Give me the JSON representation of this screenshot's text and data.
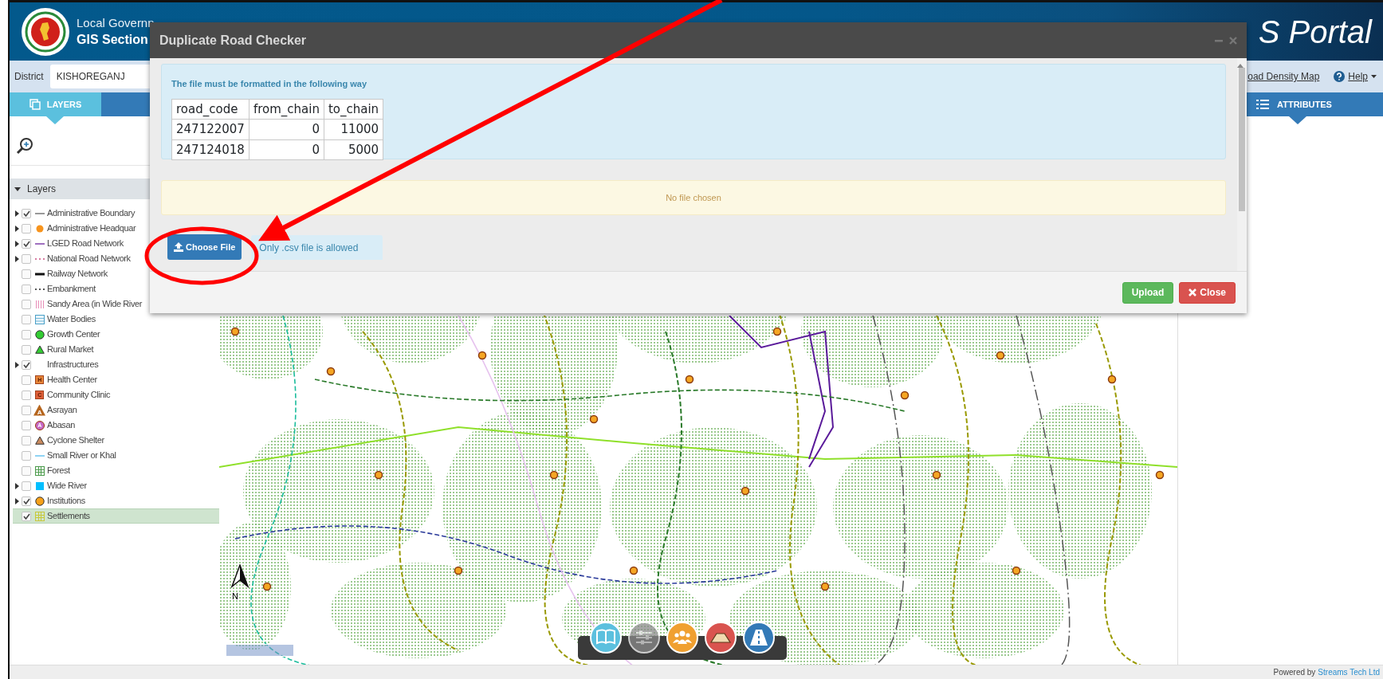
{
  "header": {
    "title_line1": "Local Governn",
    "title_line2": "GIS Section",
    "portal_title": "S Portal"
  },
  "toolbar": {
    "district_label": "District",
    "district_value": "KISHOREGANJ",
    "links": [
      {
        "label": "oad Density Map",
        "kind": "link"
      },
      {
        "label": "Help",
        "kind": "help"
      }
    ]
  },
  "left_tabs": [
    {
      "kind": "layers",
      "label": "LAYERS",
      "selected": true
    },
    {
      "kind": "search",
      "selected": false
    }
  ],
  "right_tabs": [
    {
      "kind": "attributes",
      "label": "ATTRIBUTES",
      "selected": true
    }
  ],
  "layers_panel": {
    "title": "Layers",
    "expanded": true,
    "items": [
      {
        "label": "Administrative Boundary",
        "has_children": true,
        "checked": true,
        "selected": false,
        "kind": "line",
        "color": "#999999"
      },
      {
        "label": "Administrative Headquar",
        "has_children": true,
        "checked": false,
        "selected": false,
        "kind": "dot",
        "color": "#f7941d"
      },
      {
        "label": "LGED Road Network",
        "has_children": true,
        "checked": true,
        "selected": false,
        "kind": "line",
        "color": "#a070c0"
      },
      {
        "label": "National Road Network",
        "has_children": true,
        "checked": false,
        "selected": false,
        "kind": "dots",
        "color": "#d77aa0"
      },
      {
        "label": "Railway Network",
        "has_children": false,
        "checked": false,
        "selected": false,
        "kind": "bar",
        "color": "#111111"
      },
      {
        "label": "Embankment",
        "has_children": false,
        "checked": false,
        "selected": false,
        "kind": "dots",
        "color": "#555555"
      },
      {
        "label": "Sandy Area (in Wide River",
        "has_children": false,
        "checked": false,
        "selected": false,
        "kind": "stripes",
        "color": "#e78fb8"
      },
      {
        "label": "Water Bodies",
        "has_children": false,
        "checked": false,
        "selected": false,
        "kind": "box",
        "color": "#4aa0c8"
      },
      {
        "label": "Growth Center",
        "has_children": false,
        "checked": false,
        "selected": false,
        "kind": "circle",
        "color": "#33cc33"
      },
      {
        "label": "Rural Market",
        "has_children": false,
        "checked": false,
        "selected": false,
        "kind": "triangle",
        "color": "#33cc33"
      },
      {
        "label": "Infrastructures",
        "has_children": true,
        "checked": true,
        "selected": false,
        "kind": "none"
      },
      {
        "label": "Health Center",
        "has_children": false,
        "checked": false,
        "selected": false,
        "kind": "letter-square",
        "symbol_text": "H",
        "color": "#e8873a"
      },
      {
        "label": "Community Clinic",
        "has_children": false,
        "checked": false,
        "selected": false,
        "kind": "letter-square",
        "symbol_text": "C",
        "color": "#e0603a"
      },
      {
        "label": "Asrayan",
        "has_children": false,
        "checked": false,
        "selected": false,
        "kind": "letter-triangle",
        "symbol_text": "A",
        "color": "#b5651d"
      },
      {
        "label": "Abasan",
        "has_children": false,
        "checked": false,
        "selected": false,
        "kind": "letter-circle",
        "symbol_text": "A",
        "color": "#c76ac7"
      },
      {
        "label": "Cyclone Shelter",
        "has_children": false,
        "checked": false,
        "selected": false,
        "kind": "triangle",
        "color": "#c98a5e"
      },
      {
        "label": "Small River or Khal",
        "has_children": false,
        "checked": false,
        "selected": false,
        "kind": "line",
        "color": "#8fd3f4"
      },
      {
        "label": "Forest",
        "has_children": false,
        "checked": false,
        "selected": false,
        "kind": "grid",
        "color": "#4a9a4a"
      },
      {
        "label": "Wide River",
        "has_children": true,
        "checked": false,
        "selected": false,
        "kind": "square",
        "color": "#00bfff"
      },
      {
        "label": "Institutions",
        "has_children": true,
        "checked": true,
        "selected": false,
        "kind": "circle",
        "color": "#f7a11a"
      },
      {
        "label": "Settlements",
        "has_children": false,
        "checked": true,
        "selected": true,
        "kind": "grid",
        "color": "#c8c83a"
      }
    ]
  },
  "map": {
    "north_label": "N",
    "tools": [
      {
        "kind": "book",
        "color": "#5bc0de",
        "disabled": false
      },
      {
        "kind": "sliders",
        "color": "#8a8a8a",
        "disabled": true
      },
      {
        "kind": "people",
        "color": "#f0a030",
        "disabled": false
      },
      {
        "kind": "hill",
        "color": "#d9534f",
        "disabled": false
      },
      {
        "kind": "road",
        "color": "#337ab7",
        "disabled": false
      }
    ]
  },
  "modal": {
    "title": "Duplicate Road Checker",
    "info_text": "The file must be formatted in the following way",
    "sample_table": {
      "columns": [
        "road_code",
        "from_chain",
        "to_chain"
      ],
      "rows": [
        [
          "247122007",
          "0",
          "11000"
        ],
        [
          "247124018",
          "0",
          "5000"
        ]
      ]
    },
    "file_status": "No file chosen",
    "choose_button": "Choose File",
    "file_hint": "Only .csv file is allowed",
    "buttons": [
      {
        "label": "Upload",
        "kind": "success"
      },
      {
        "label": "Close",
        "kind": "danger"
      }
    ]
  },
  "footer": {
    "prefix": "Powered by",
    "link": "Streams Tech Ltd"
  }
}
